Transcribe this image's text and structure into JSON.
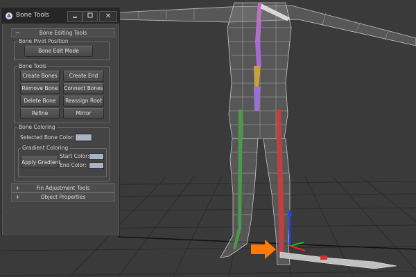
{
  "window": {
    "title": "Bone Tools",
    "minimize_icon": "minimize-icon",
    "restore_icon": "restore-icon",
    "close_glyph": "✕"
  },
  "rollouts": {
    "bone_editing": {
      "sign": "−",
      "label": "Bone Editing Tools"
    },
    "fin_adjustment": {
      "sign": "+",
      "label": "Fin Adjustment Tools"
    },
    "object_properties": {
      "sign": "+",
      "label": "Object Properties"
    }
  },
  "bone_pivot": {
    "group_label": "Bone Pivot Position",
    "edit_mode_button": "Bone Edit Mode"
  },
  "bone_tools": {
    "group_label": "Bone Tools",
    "create_bones": "Create Bones",
    "create_end": "Create End",
    "remove_bone": "Remove Bone",
    "connect_bones": "Connect Bones",
    "delete_bone": "Delete Bone",
    "reassign_root": "Reassign Root",
    "refine": "Refine",
    "mirror": "Mirror"
  },
  "bone_coloring": {
    "group_label": "Bone Coloring",
    "selected_color_label": "Selected Bone Color:",
    "selected_color": "#a9b3c4",
    "gradient_group_label": "Gradient Coloring",
    "apply_gradient": "Apply Gradient",
    "start_color_label": "Start Color:",
    "start_color": "#a9b3c4",
    "end_color_label": "End Color:",
    "end_color": "#a9b3c4"
  },
  "scene": {
    "background": "#3a3a3a",
    "grid_color": "#2c2c2c",
    "mesh_color": "#b8b8b8",
    "pointer_arrow_color": "#ff7a00"
  }
}
